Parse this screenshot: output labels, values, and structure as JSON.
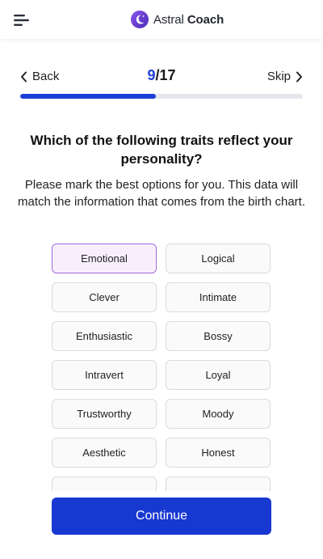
{
  "header": {
    "brand_light": "Astral",
    "brand_bold": "Coach",
    "menu_icon": "menu-icon",
    "logo_icon": "moon-logo-icon"
  },
  "nav": {
    "back_label": "Back",
    "skip_label": "Skip",
    "step_current": "9",
    "step_separator": "/",
    "step_total": "17",
    "progress_fraction": 0.48
  },
  "question": {
    "title": "Which of the following traits reflect your personality?",
    "subtitle": "Please mark the best options for you. This data will match the information that comes from the birth chart."
  },
  "options": [
    {
      "label": "Emotional",
      "selected": true
    },
    {
      "label": "Logical",
      "selected": false
    },
    {
      "label": "Clever",
      "selected": false
    },
    {
      "label": "Intimate",
      "selected": false
    },
    {
      "label": "Enthusiastic",
      "selected": false
    },
    {
      "label": "Bossy",
      "selected": false
    },
    {
      "label": "Intravert",
      "selected": false
    },
    {
      "label": "Loyal",
      "selected": false
    },
    {
      "label": "Trustworthy",
      "selected": false
    },
    {
      "label": "Moody",
      "selected": false
    },
    {
      "label": "Aesthetic",
      "selected": false
    },
    {
      "label": "Honest",
      "selected": false
    },
    {
      "label": "",
      "selected": false
    },
    {
      "label": "",
      "selected": false
    }
  ],
  "footer": {
    "continue_label": "Continue"
  },
  "colors": {
    "accent": "#1c3ed6",
    "selected_border": "#a46be0",
    "selected_bg": "#f7f0fc",
    "logo_purple": "#6b3fd4"
  }
}
